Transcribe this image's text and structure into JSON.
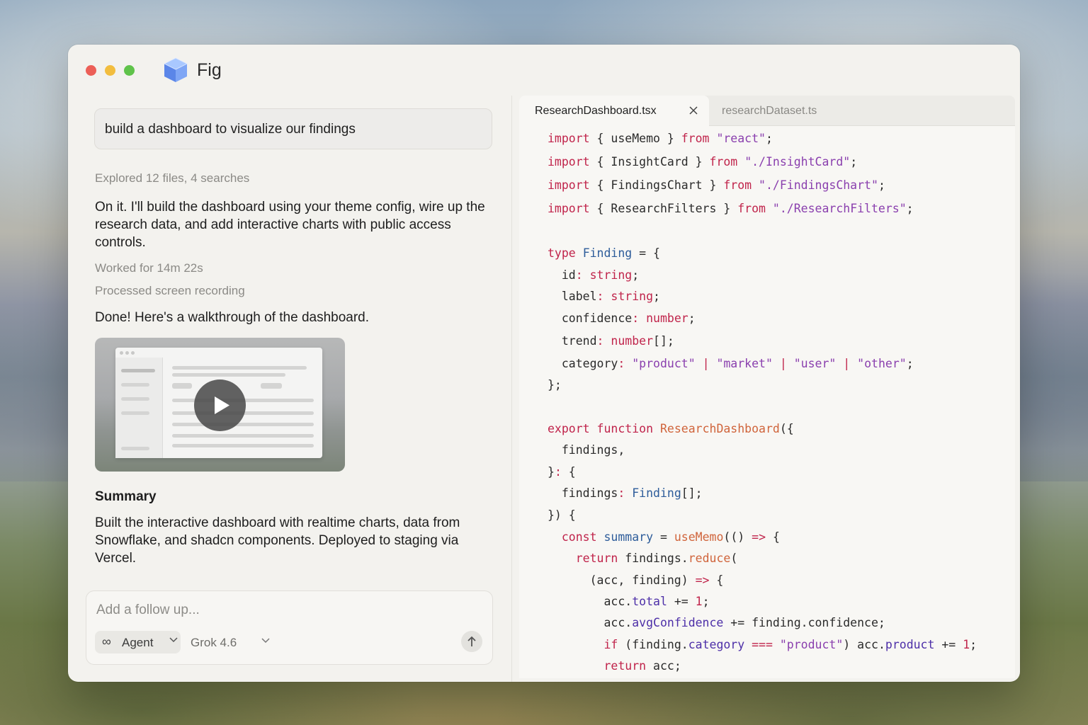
{
  "app": {
    "title": "Fig"
  },
  "chat": {
    "prompt": "build a dashboard to visualize our findings",
    "explored": "Explored 12 files, 4 searches",
    "response1": "On it. I'll build the dashboard using your theme config, wire up the research data, and add interactive charts with public access controls.",
    "worked_for": "Worked for 14m 22s",
    "processed": "Processed screen recording",
    "done": "Done! Here's a walkthrough of the dashboard.",
    "summary_title": "Summary",
    "summary_text": "Built the interactive dashboard with realtime charts, data from Snowflake, and shadcn components. Deployed to staging via Vercel."
  },
  "composer": {
    "placeholder": "Add a follow up...",
    "agent_icon": "infinity-icon",
    "agent_label": "Agent",
    "model_label": "Grok 4.6"
  },
  "editor": {
    "tabs": [
      {
        "label": "ResearchDashboard.tsx",
        "active": true
      },
      {
        "label": "researchDataset.ts",
        "active": false
      }
    ]
  },
  "code": [
    [
      [
        "kw",
        "import"
      ],
      [
        "p",
        " { useMemo } "
      ],
      [
        "kw",
        "from"
      ],
      [
        "p",
        " "
      ],
      [
        "st",
        "\"react\""
      ],
      [
        "p",
        ";"
      ]
    ],
    [
      [
        "kw",
        "import"
      ],
      [
        "p",
        " { InsightCard } "
      ],
      [
        "kw",
        "from"
      ],
      [
        "p",
        " "
      ],
      [
        "st",
        "\"./InsightCard\""
      ],
      [
        "p",
        ";"
      ]
    ],
    [
      [
        "kw",
        "import"
      ],
      [
        "p",
        " { FindingsChart } "
      ],
      [
        "kw",
        "from"
      ],
      [
        "p",
        " "
      ],
      [
        "st",
        "\"./FindingsChart\""
      ],
      [
        "p",
        ";"
      ]
    ],
    [
      [
        "kw",
        "import"
      ],
      [
        "p",
        " { ResearchFilters } "
      ],
      [
        "kw",
        "from"
      ],
      [
        "p",
        " "
      ],
      [
        "st",
        "\"./ResearchFilters\""
      ],
      [
        "p",
        ";"
      ]
    ],
    [
      [
        "kw",
        "type"
      ],
      [
        "p",
        " "
      ],
      [
        "ty",
        "Finding"
      ],
      [
        "p",
        " = {"
      ]
    ],
    [
      [
        "p",
        "  id"
      ],
      [
        "op",
        ":"
      ],
      [
        "p",
        " "
      ],
      [
        "kw",
        "string"
      ],
      [
        "p",
        ";"
      ]
    ],
    [
      [
        "p",
        "  label"
      ],
      [
        "op",
        ":"
      ],
      [
        "p",
        " "
      ],
      [
        "kw",
        "string"
      ],
      [
        "p",
        ";"
      ]
    ],
    [
      [
        "p",
        "  confidence"
      ],
      [
        "op",
        ":"
      ],
      [
        "p",
        " "
      ],
      [
        "kw",
        "number"
      ],
      [
        "p",
        ";"
      ]
    ],
    [
      [
        "p",
        "  trend"
      ],
      [
        "op",
        ":"
      ],
      [
        "p",
        " "
      ],
      [
        "kw",
        "number"
      ],
      [
        "p",
        "[];"
      ]
    ],
    [
      [
        "p",
        "  category"
      ],
      [
        "op",
        ":"
      ],
      [
        "p",
        " "
      ],
      [
        "st",
        "\"product\""
      ],
      [
        "p",
        " "
      ],
      [
        "op",
        "|"
      ],
      [
        "p",
        " "
      ],
      [
        "st",
        "\"market\""
      ],
      [
        "p",
        " "
      ],
      [
        "op",
        "|"
      ],
      [
        "p",
        " "
      ],
      [
        "st",
        "\"user\""
      ],
      [
        "p",
        " "
      ],
      [
        "op",
        "|"
      ],
      [
        "p",
        " "
      ],
      [
        "st",
        "\"other\""
      ],
      [
        "p",
        ";"
      ]
    ],
    [
      [
        "p",
        "};"
      ]
    ],
    [
      [
        "kw",
        "export"
      ],
      [
        "p",
        " "
      ],
      [
        "kw",
        "function"
      ],
      [
        "p",
        " "
      ],
      [
        "fn",
        "ResearchDashboard"
      ],
      [
        "p",
        "({"
      ]
    ],
    [
      [
        "p",
        "  findings,"
      ]
    ],
    [
      [
        "p",
        "}"
      ],
      [
        "op",
        ":"
      ],
      [
        "p",
        " {"
      ]
    ],
    [
      [
        "p",
        "  findings"
      ],
      [
        "op",
        ":"
      ],
      [
        "p",
        " "
      ],
      [
        "ty",
        "Finding"
      ],
      [
        "p",
        "[];"
      ]
    ],
    [
      [
        "p",
        "}) {"
      ]
    ],
    [
      [
        "p",
        "  "
      ],
      [
        "kw",
        "const"
      ],
      [
        "p",
        " "
      ],
      [
        "ty",
        "summary"
      ],
      [
        "p",
        " = "
      ],
      [
        "fn",
        "useMemo"
      ],
      [
        "p",
        "(() "
      ],
      [
        "op",
        "=>"
      ],
      [
        "p",
        " {"
      ]
    ],
    [
      [
        "p",
        "    "
      ],
      [
        "kw",
        "return"
      ],
      [
        "p",
        " findings."
      ],
      [
        "fn",
        "reduce"
      ],
      [
        "p",
        "("
      ]
    ],
    [
      [
        "p",
        "      (acc, finding) "
      ],
      [
        "op",
        "=>"
      ],
      [
        "p",
        " {"
      ]
    ],
    [
      [
        "p",
        "        acc."
      ],
      [
        "pr",
        "total"
      ],
      [
        "p",
        " += "
      ],
      [
        "num",
        "1"
      ],
      [
        "p",
        ";"
      ]
    ],
    [
      [
        "p",
        "        acc."
      ],
      [
        "pr",
        "avgConfidence"
      ],
      [
        "p",
        " += finding.confidence;"
      ]
    ],
    [
      [
        "p",
        "        "
      ],
      [
        "kw",
        "if"
      ],
      [
        "p",
        " (finding."
      ],
      [
        "pr",
        "category"
      ],
      [
        "p",
        " "
      ],
      [
        "op",
        "==="
      ],
      [
        "p",
        " "
      ],
      [
        "st",
        "\"product\""
      ],
      [
        "p",
        ") acc."
      ],
      [
        "pr",
        "product"
      ],
      [
        "p",
        " += "
      ],
      [
        "num",
        "1"
      ],
      [
        "p",
        ";"
      ]
    ],
    [
      [
        "p",
        "        "
      ],
      [
        "kw",
        "return"
      ],
      [
        "p",
        " acc;"
      ]
    ]
  ]
}
